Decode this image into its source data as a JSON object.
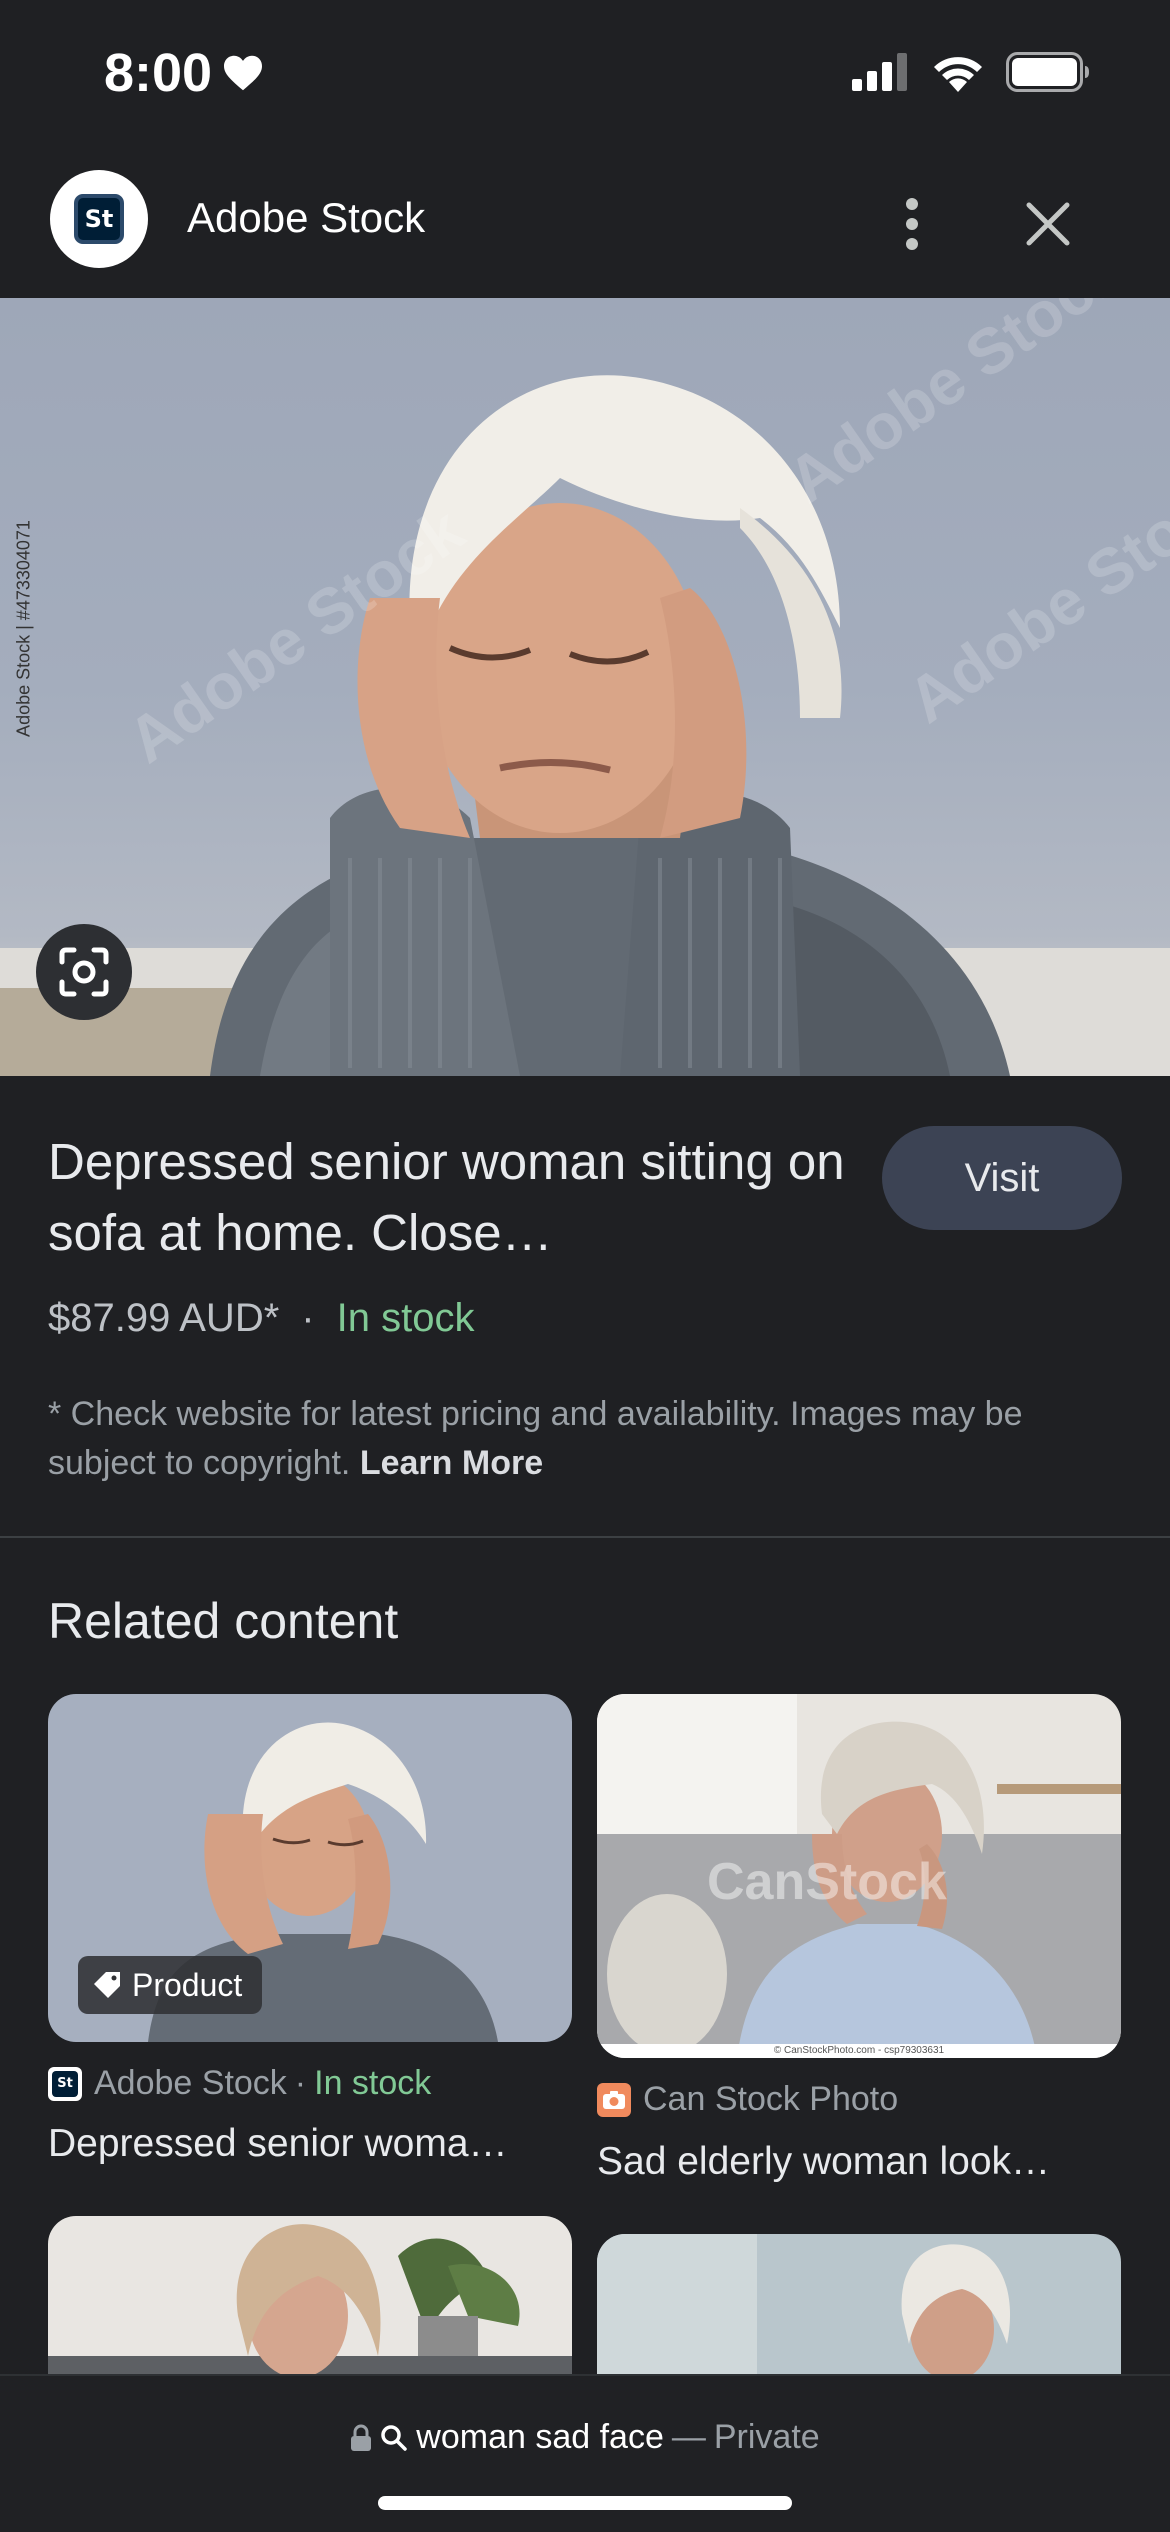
{
  "status_bar": {
    "time": "8:00"
  },
  "header": {
    "site_logo_text": "St",
    "site_name": "Adobe Stock"
  },
  "hero": {
    "watermark": "Adobe Stock",
    "side_credit": "Adobe Stock | #473304071"
  },
  "product": {
    "title": "Depressed senior woman sitting on sofa at home. Close…",
    "visit_label": "Visit",
    "price": "$87.99 AUD*",
    "separator": "·",
    "stock_status": "In stock",
    "disclaimer": "* Check website for latest pricing and availability. Images may be subject to copyright.",
    "learn_more": "Learn More"
  },
  "related": {
    "heading": "Related content",
    "cards": [
      {
        "chip": "Product",
        "source": "Adobe Stock",
        "source_sep": "·",
        "stock": "In stock",
        "title": "Depressed senior woma…"
      },
      {
        "watermark": "CanStock",
        "footer_credit": "© CanStockPhoto.com - csp79303631",
        "source": "Can Stock Photo",
        "title": "Sad elderly woman look…"
      }
    ]
  },
  "bottom_bar": {
    "query": "woman sad face",
    "dash": "—",
    "mode": "Private"
  },
  "colors": {
    "background": "#1f2023",
    "accent_green": "#81c995",
    "visit_button": "#3c4354"
  }
}
